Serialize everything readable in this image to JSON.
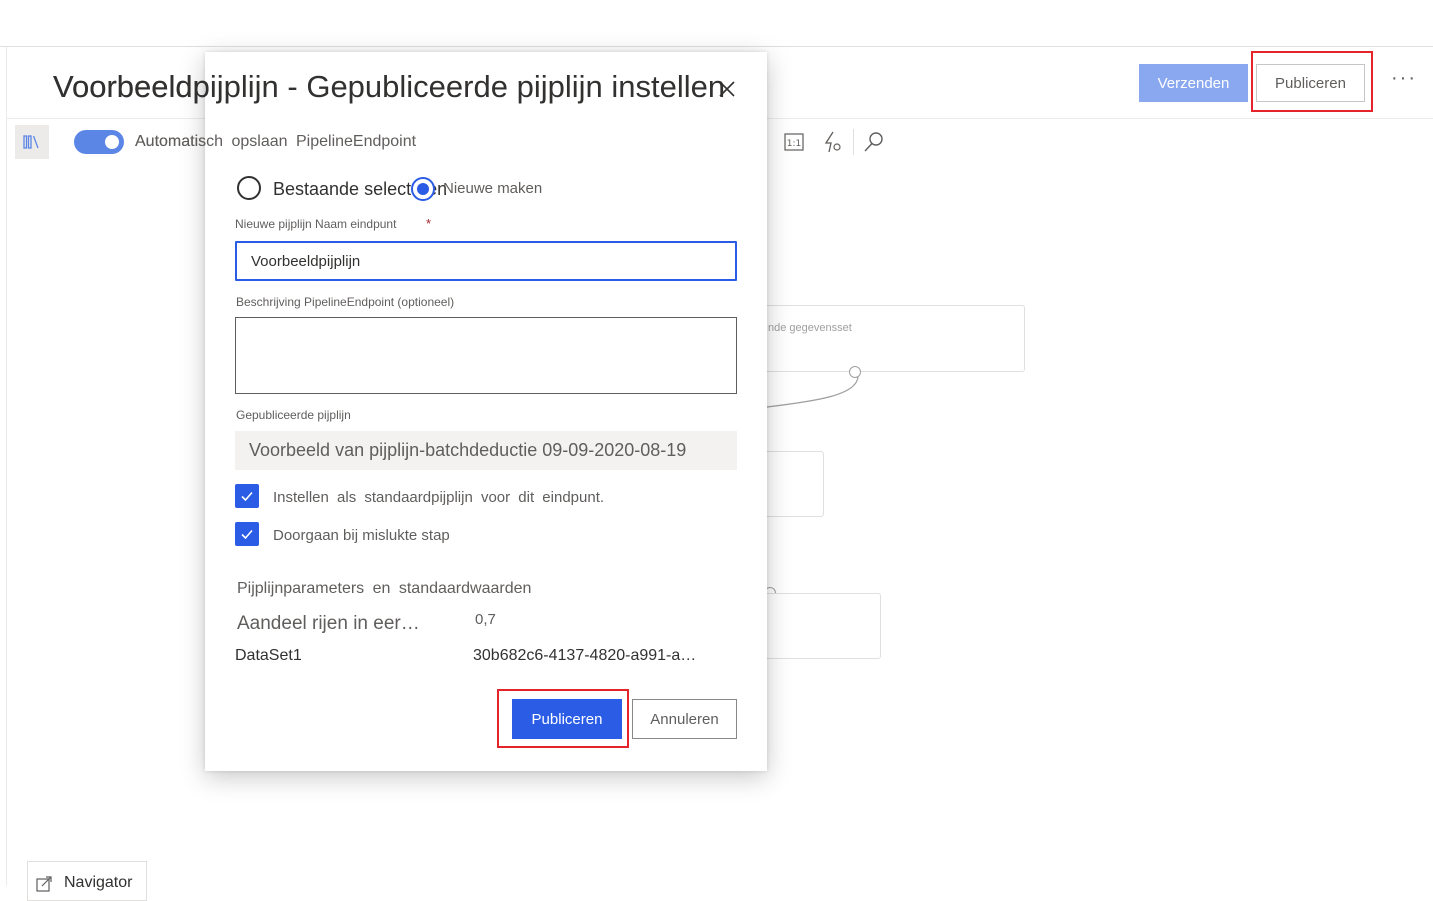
{
  "header": {
    "title": "Voorbeeldpijplijn - Gepubliceerde pijplijn instellen",
    "submit_label": "Verzenden",
    "publish_label": "Publiceren",
    "more_label": "···"
  },
  "toolbar": {
    "autosave_label": "Automatisch opslaan",
    "autosave_on": true
  },
  "canvas": {
    "node_label": "nde gegevensset"
  },
  "navigator": {
    "label": "Navigator"
  },
  "dialog": {
    "subtitle": "PipelineEndpoint",
    "radio_existing": "Bestaande selecteren",
    "radio_new": "Nieuwe maken",
    "name_label": "Nieuwe pijplijn Naam eindpunt",
    "required_mark": "*",
    "name_value": "Voorbeeldpijplijn",
    "description_label": "Beschrijving PipelineEndpoint (optioneel)",
    "published_label": "Gepubliceerde pijplijn",
    "published_value": "Voorbeeld van pijplijn-batchdeductie 09-09-2020-08-19",
    "checkbox_default": "Instellen als standaardpijplijn voor dit eindpunt.",
    "checkbox_continue": "Doorgaan bij mislukte stap",
    "params_heading": "Pijplijnparameters en standaardwaarden",
    "params": [
      {
        "name": "Aandeel rijen in eer…",
        "value": "0,7"
      },
      {
        "name": "DataSet1",
        "value": "30b682c6-4137-4820-a991-a…"
      }
    ],
    "publish_label": "Publiceren",
    "cancel_label": "Annuleren"
  },
  "colors": {
    "accent": "#2b5ce6",
    "highlight": "#e3242b"
  }
}
